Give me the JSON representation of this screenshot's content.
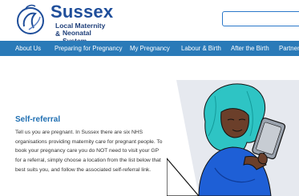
{
  "brand": {
    "name": "Sussex",
    "subtitle_line1": "Local Maternity &",
    "subtitle_line2": "Neonatal System"
  },
  "search": {
    "placeholder": ""
  },
  "nav": {
    "items": [
      {
        "label": "About Us"
      },
      {
        "label": "Preparing for Pregnancy"
      },
      {
        "label": "My Pregnancy"
      },
      {
        "label": "Labour & Birth"
      },
      {
        "label": "After the Birth"
      },
      {
        "label": "Partner"
      }
    ]
  },
  "main": {
    "title": "Self-referral",
    "body": "Tell us you are pregnant. In Sussex there are six NHS organisations providing maternity care for pregnant people. To book your pregnancy care you do NOT need to visit your GP for a referral, simply choose a location from the list below that best suits you, and follow the associated self-referral link."
  },
  "colors": {
    "brand_blue": "#1f4e9a",
    "nav_bg": "#2a7ab8",
    "title_blue": "#1f6fb2",
    "hair": "#2ec4c4",
    "dress": "#1e5fd6"
  },
  "icons": {
    "logo": "sussex-lmns-logo",
    "illustration": "pregnant-woman-with-tablet-illustration"
  }
}
